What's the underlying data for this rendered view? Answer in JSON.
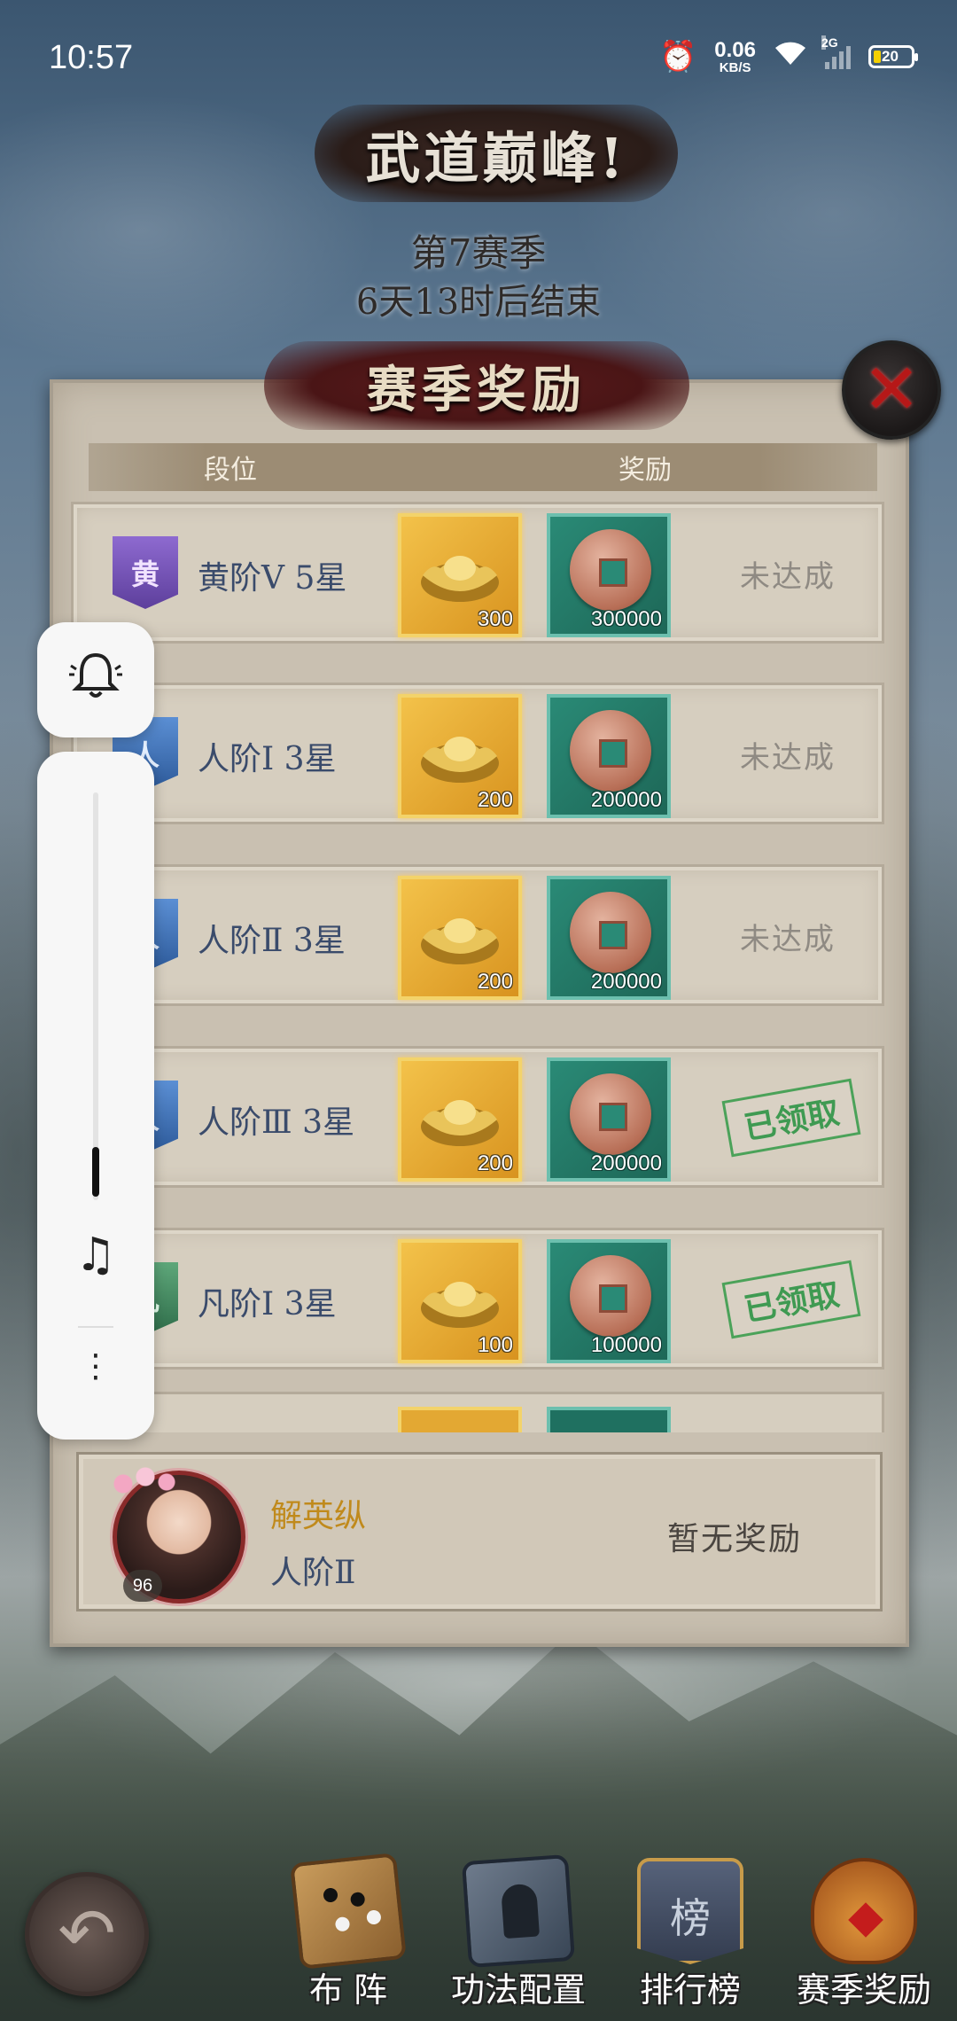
{
  "status_bar": {
    "time": "10:57",
    "net_speed": "0.06",
    "net_unit": "KB/S",
    "signal_label": "2G",
    "battery": "20",
    "icons": [
      "alarm-icon",
      "wifi-icon",
      "signal-icon",
      "battery-icon"
    ]
  },
  "header": {
    "title": "武道巅峰!",
    "season": "第7赛季",
    "timer": "6天13时后结束"
  },
  "panel": {
    "title": "赛季奖励",
    "close_icon": "close-icon",
    "columns": [
      "段位",
      "奖励"
    ],
    "rows": [
      {
        "emblem": "黄",
        "emblem_color": "#7a55bd",
        "rank": "黄阶Ⅴ 5星",
        "gold": "300",
        "coins": "300000",
        "status": "未达成",
        "claimed": false
      },
      {
        "emblem": "人",
        "emblem_color": "#3d6fb3",
        "rank": "人阶Ⅰ 3星",
        "gold": "200",
        "coins": "200000",
        "status": "未达成",
        "claimed": false
      },
      {
        "emblem": "人",
        "emblem_color": "#3d6fb3",
        "rank": "人阶Ⅱ 3星",
        "gold": "200",
        "coins": "200000",
        "status": "未达成",
        "claimed": false
      },
      {
        "emblem": "人",
        "emblem_color": "#3d6fb3",
        "rank": "人阶Ⅲ 3星",
        "gold": "200",
        "coins": "200000",
        "status": "已领取",
        "claimed": true
      },
      {
        "emblem": "凡",
        "emblem_color": "#3f8a5c",
        "rank": "凡阶Ⅰ 3星",
        "gold": "100",
        "coins": "100000",
        "status": "已领取",
        "claimed": true
      }
    ],
    "self": {
      "name": "解英纵",
      "rank": "人阶Ⅱ",
      "level": "96",
      "reward_text": "暂无奖励"
    }
  },
  "floating_controls": {
    "bell_icon": "bell-icon",
    "music_icon": "music-note-icon",
    "more_icon": "more-icon",
    "volume_level": 0.13
  },
  "bottom_nav": {
    "back_icon": "back-arrow-icon",
    "items": [
      {
        "label": "布 阵",
        "icon": "go-board-icon"
      },
      {
        "label": "功法配置",
        "icon": "scripture-book-icon"
      },
      {
        "label": "排行榜",
        "icon": "ranking-banner-icon",
        "glyph": "榜"
      },
      {
        "label": "赛季奖励",
        "icon": "treasure-bag-icon"
      }
    ]
  }
}
